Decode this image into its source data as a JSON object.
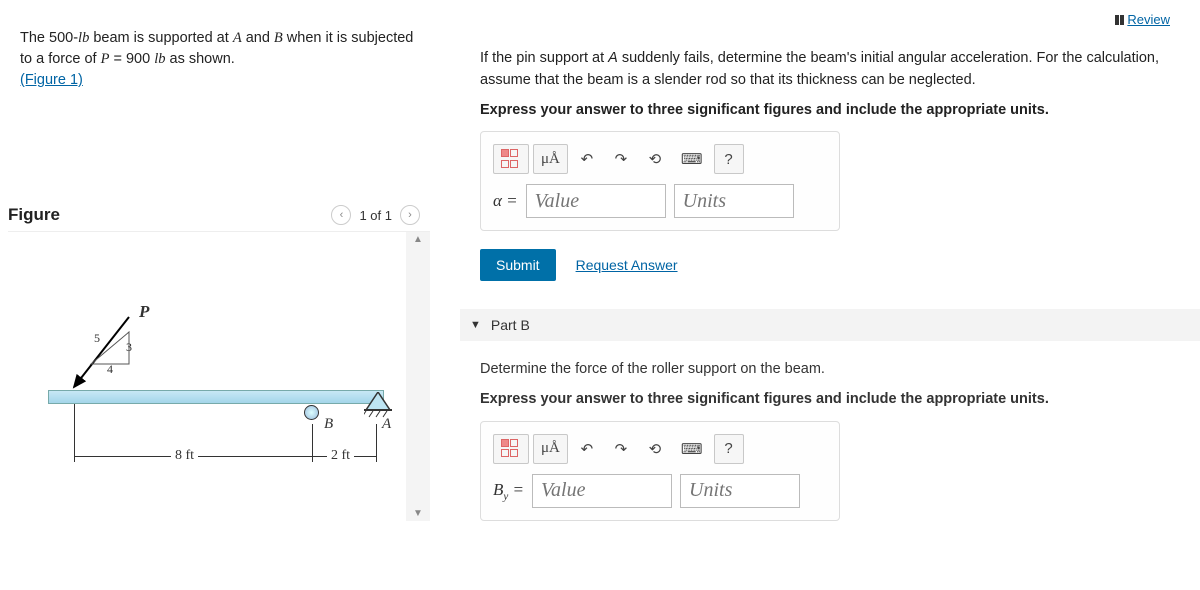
{
  "review_label": "Review",
  "problem": {
    "text1": "The 500-",
    "unit_lb1": "lb",
    "text2": " beam is supported at ",
    "A": "A",
    "text3": " and ",
    "B": "B",
    "text4": " when it is subjected to a force of ",
    "P": "P",
    "eq": " = 900 ",
    "unit_lb2": "lb",
    "text5": " as shown.",
    "figure_link": "(Figure 1)"
  },
  "figure": {
    "heading": "Figure",
    "nav": "1 of 1",
    "labels": {
      "P": "P",
      "B": "B",
      "A": "A",
      "tri5": "5",
      "tri4": "4",
      "tri3": "3",
      "dim8": "8 ft",
      "dim2": "2 ft"
    }
  },
  "partA": {
    "prompt1": "If the pin support at ",
    "A_ref": "A",
    "prompt2": " suddenly fails, determine the beam's initial angular acceleration. For the calculation, assume that the beam is a slender rod so that its thickness can be neglected.",
    "bold": "Express your answer to three significant figures and include the appropriate units.",
    "var": "α =",
    "value_ph": "Value",
    "units_ph": "Units",
    "submit": "Submit",
    "request": "Request Answer",
    "muA": "μÅ",
    "help": "?"
  },
  "partB": {
    "header": "Part B",
    "prompt": "Determine the force of the roller support on the beam.",
    "bold": "Express your answer to three significant figures and include the appropriate units.",
    "var_pre": "B",
    "var_sub": "y",
    "var_post": " =",
    "value_ph": "Value",
    "units_ph": "Units",
    "muA": "μÅ",
    "help": "?"
  }
}
